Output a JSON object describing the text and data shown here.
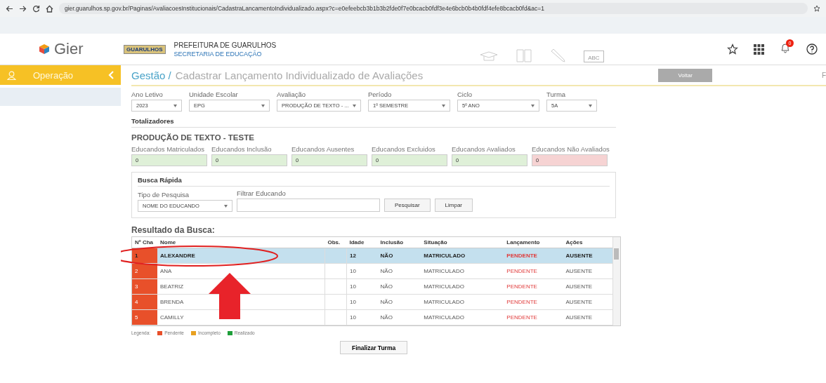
{
  "browser": {
    "url": "gier.guarulhos.sp.gov.br/Paginas/AvaliacoesInstitucionais/CadastraLancamentoIndividualizado.aspx?c=e0efeebcb3b1b3b2fde0f7e0bcacb0fdf3e4e6bcb0b4b0fdf4efe8bcacb0fd&ac=1"
  },
  "header": {
    "app_name": "Gier",
    "logo_text": "GUARULHOS",
    "org_title": "PREFEITURA DE GUARULHOS",
    "org_subtitle": "SECRETARIA DE EDUCAÇÃO",
    "abc_label": "ABC",
    "notification_count": "0"
  },
  "sidebar": {
    "title": "Operação"
  },
  "page": {
    "breadcrumb": "Gestão /",
    "title": "Cadastrar Lançamento Individualizado de Avaliações",
    "back_button": "Voltar",
    "edge_text": "F"
  },
  "filters": [
    {
      "label": "Ano Letivo",
      "value": "2023"
    },
    {
      "label": "Unidade Escolar",
      "value": "EPG"
    },
    {
      "label": "Avaliação",
      "value": "PRODUÇÃO DE TEXTO - ..."
    },
    {
      "label": "Período",
      "value": "1º SEMESTRE"
    },
    {
      "label": "Ciclo",
      "value": "5º ANO"
    },
    {
      "label": "Turma",
      "value": "5A"
    }
  ],
  "totals": {
    "heading": "Totalizadores",
    "assessment": "PRODUÇÃO DE TEXTO - TESTE",
    "items": [
      {
        "label": "Educandos Matriculados",
        "value": "0",
        "kind": "ok"
      },
      {
        "label": "Educandos Inclusão",
        "value": "0",
        "kind": "ok"
      },
      {
        "label": "Educandos Ausentes",
        "value": "0",
        "kind": "ok"
      },
      {
        "label": "Educandos Excluidos",
        "value": "0",
        "kind": "ok"
      },
      {
        "label": "Educandos Avaliados",
        "value": "0",
        "kind": "ok"
      },
      {
        "label": "Educandos Não Avaliados",
        "value": "0",
        "kind": "alert"
      }
    ]
  },
  "quick_search": {
    "title": "Busca Rápida",
    "type_label": "Tipo de Pesquisa",
    "type_value": "NOME DO EDUCANDO",
    "filter_label": "Filtrar Educando",
    "search_button": "Pesquisar",
    "clear_button": "Limpar"
  },
  "results": {
    "title": "Resultado da Busca:",
    "columns": [
      "Nº Cha",
      "Nome",
      "Obs.",
      "Idade",
      "Inclusão",
      "Situação",
      "Lançamento",
      "Ações"
    ],
    "rows": [
      {
        "number": "1",
        "name": "ALEXANDRE",
        "age": "12",
        "inclusion": "NÃO",
        "status": "MATRICULADO",
        "launch": "PENDENTE",
        "action": "AUSENTE",
        "selected": true,
        "color": "#e8502a"
      },
      {
        "number": "2",
        "name": "ANA",
        "age": "10",
        "inclusion": "NÃO",
        "status": "MATRICULADO",
        "launch": "PENDENTE",
        "action": "AUSENTE",
        "selected": false,
        "color": "#e8502a"
      },
      {
        "number": "3",
        "name": "BEATRIZ",
        "age": "10",
        "inclusion": "NÃO",
        "status": "MATRICULADO",
        "launch": "PENDENTE",
        "action": "AUSENTE",
        "selected": false,
        "color": "#e8502a"
      },
      {
        "number": "4",
        "name": "BRENDA",
        "age": "10",
        "inclusion": "NÃO",
        "status": "MATRICULADO",
        "launch": "PENDENTE",
        "action": "AUSENTE",
        "selected": false,
        "color": "#e8502a"
      },
      {
        "number": "5",
        "name": "CAMILLY",
        "age": "10",
        "inclusion": "NÃO",
        "status": "MATRICULADO",
        "launch": "PENDENTE",
        "action": "AUSENTE",
        "selected": false,
        "color": "#e8502a"
      }
    ]
  },
  "legend": {
    "label": "Legenda:",
    "items": [
      {
        "label": "Pendente",
        "color": "#e8502a"
      },
      {
        "label": "Incompleto",
        "color": "#e8a020"
      },
      {
        "label": "Realizado",
        "color": "#1e9e3a"
      }
    ]
  },
  "finish_button": "Finalizar Turma"
}
